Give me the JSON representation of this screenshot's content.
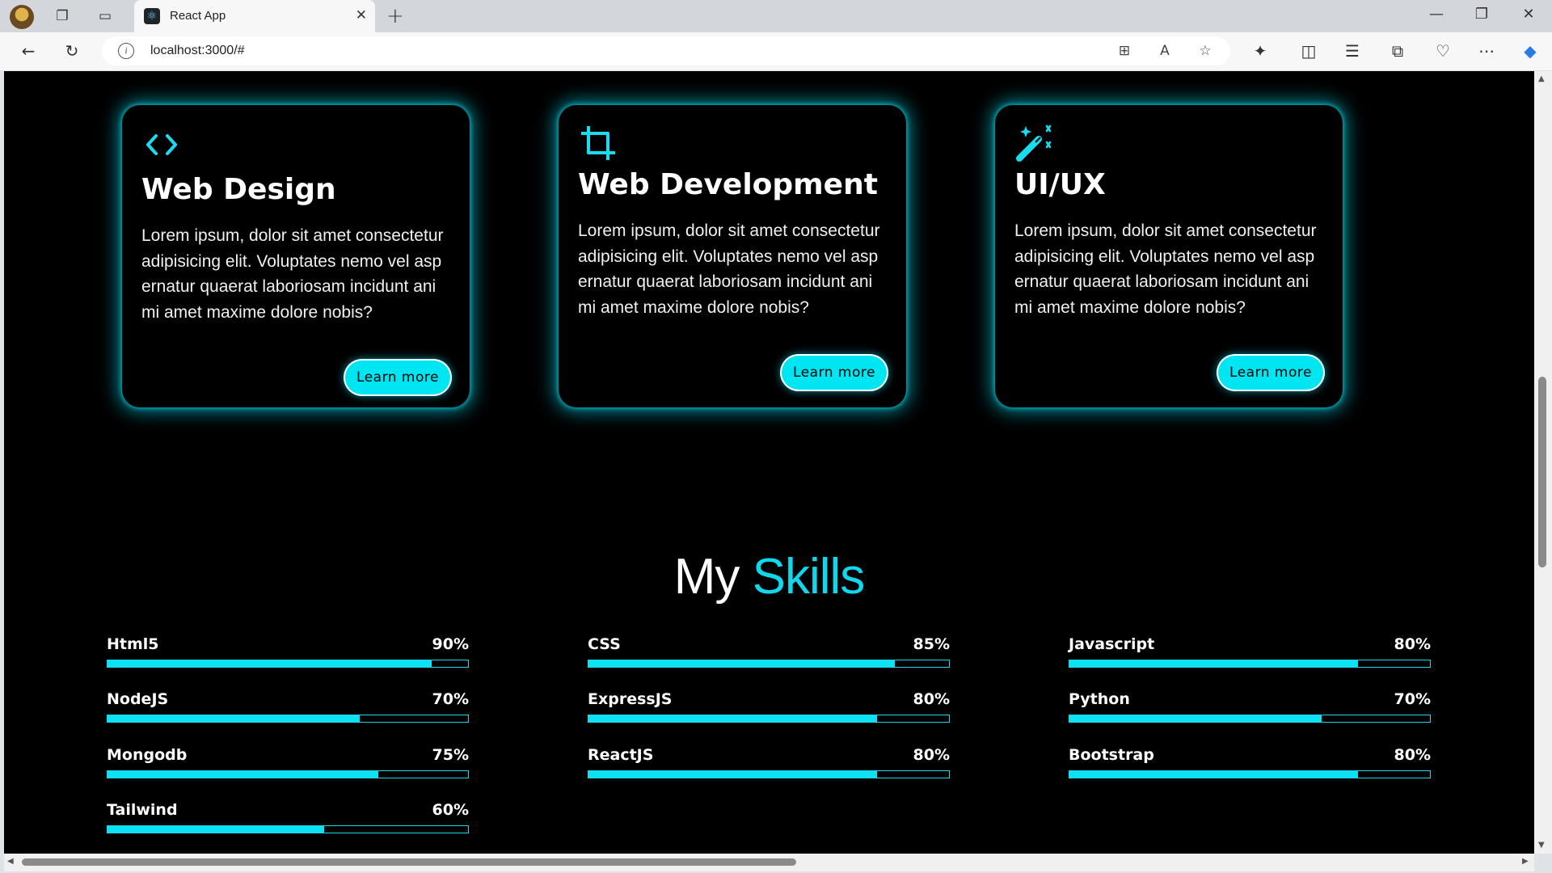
{
  "browser": {
    "tab_title": "React App",
    "url": "localhost:3000/#"
  },
  "services": [
    {
      "icon": "code-brackets-icon",
      "title": "Web Design",
      "text": "Lorem ipsum, dolor sit amet consectetur adipisicing elit. Voluptates nemo vel asp ernatur quaerat laboriosam incidunt ani mi amet maxime dolore nobis?",
      "button": "Learn more"
    },
    {
      "icon": "crop-icon",
      "title": "Web Development",
      "text": "Lorem ipsum, dolor sit amet consectetur adipisicing elit. Voluptates nemo vel asp ernatur quaerat laboriosam incidunt ani mi amet maxime dolore nobis?",
      "button": "Learn more"
    },
    {
      "icon": "magic-wand-icon",
      "title": "UI/UX",
      "text": "Lorem ipsum, dolor sit amet consectetur adipisicing elit. Voluptates nemo vel asp ernatur quaerat laboriosam incidunt ani mi amet maxime dolore nobis?",
      "button": "Learn more"
    }
  ],
  "skills_section": {
    "title_plain": "My",
    "title_accent": "Skills",
    "accent_color": "#0fd8ec",
    "skills": [
      {
        "name": "Html5",
        "percent_label": "90%",
        "percent": 90
      },
      {
        "name": "CSS",
        "percent_label": "85%",
        "percent": 85
      },
      {
        "name": "Javascript",
        "percent_label": "80%",
        "percent": 80
      },
      {
        "name": "NodeJS",
        "percent_label": "70%",
        "percent": 70
      },
      {
        "name": "ExpressJS",
        "percent_label": "80%",
        "percent": 80
      },
      {
        "name": "Python",
        "percent_label": "70%",
        "percent": 70
      },
      {
        "name": "Mongodb",
        "percent_label": "75%",
        "percent": 75
      },
      {
        "name": "ReactJS",
        "percent_label": "80%",
        "percent": 80
      },
      {
        "name": "Bootstrap",
        "percent_label": "80%",
        "percent": 80
      },
      {
        "name": "Tailwind",
        "percent_label": "60%",
        "percent": 60
      }
    ]
  }
}
